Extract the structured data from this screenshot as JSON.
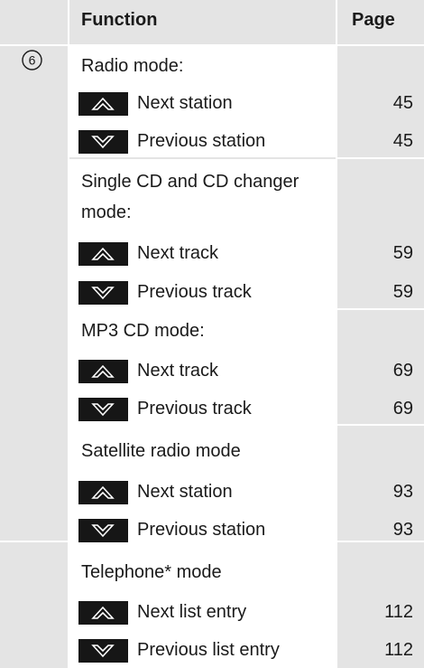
{
  "header": {
    "function_label": "Function",
    "page_label": "Page"
  },
  "marker": "6",
  "sections": {
    "radio": {
      "title": "Radio mode:",
      "rows": [
        {
          "key": "up-arrow-icon",
          "label": "Next station",
          "page": "45"
        },
        {
          "key": "down-arrow-icon",
          "label": "Previous station",
          "page": "45"
        }
      ]
    },
    "cd": {
      "title_line1": "Single CD and CD changer",
      "title_line2": "mode:",
      "rows": [
        {
          "key": "up-arrow-icon",
          "label": "Next track",
          "page": "59"
        },
        {
          "key": "down-arrow-icon",
          "label": "Previous track",
          "page": "59"
        }
      ]
    },
    "mp3": {
      "title": "MP3 CD mode:",
      "rows": [
        {
          "key": "up-arrow-icon",
          "label": "Next track",
          "page": "69"
        },
        {
          "key": "down-arrow-icon",
          "label": "Previous track",
          "page": "69"
        }
      ]
    },
    "satellite": {
      "title": "Satellite radio mode",
      "rows": [
        {
          "key": "up-arrow-icon",
          "label": "Next station",
          "page": "93"
        },
        {
          "key": "down-arrow-icon",
          "label": "Previous station",
          "page": "93"
        }
      ]
    },
    "telephone": {
      "title": "Telephone* mode",
      "rows": [
        {
          "key": "up-arrow-icon",
          "label": "Next list entry",
          "page": "112"
        },
        {
          "key": "down-arrow-icon",
          "label": "Previous list entry",
          "page": "112"
        }
      ]
    }
  }
}
